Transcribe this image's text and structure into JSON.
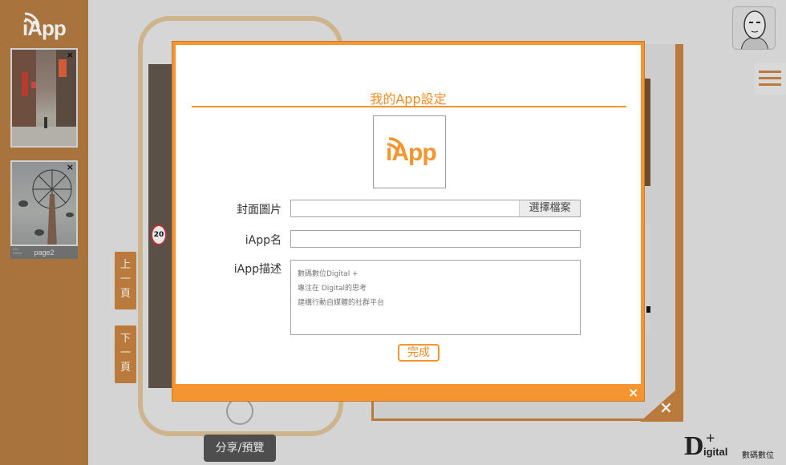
{
  "app": {
    "logo_text": "iApp"
  },
  "sidebar": {
    "pages": [
      {
        "close": "×",
        "label": ""
      },
      {
        "close": "×",
        "label": "page2"
      }
    ]
  },
  "phone": {
    "prev_page": "上\n一\n頁",
    "next_page": "下\n一\n頁",
    "share_label": "分享/預覽",
    "sign_text": "20"
  },
  "brand": {
    "letter": "D",
    "plus": "+",
    "word": "igital",
    "zh": "數碼數位"
  },
  "modal": {
    "title": "我的App設定",
    "logo_text": "iApp",
    "cover_label": "封面圖片",
    "file_button": "選擇檔案",
    "name_label": "iApp名",
    "name_value": "",
    "desc_label": "iApp描述",
    "desc_lines": [
      "數碼數位Digital +",
      "專注在 Digital的思考",
      "建構行動自媒體的社群平台"
    ],
    "done_label": "完成",
    "close_label": "×"
  },
  "panel": {
    "close_label": "×"
  },
  "colors": {
    "accent": "#f5952f",
    "sidebar": "#a9733d",
    "dim_overlay": "#d4d4d4"
  }
}
